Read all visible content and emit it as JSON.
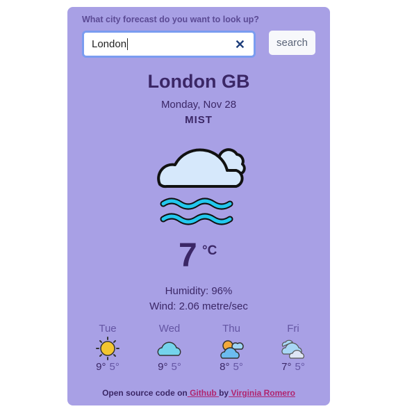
{
  "search": {
    "prompt": "What city forecast do you want to look up?",
    "value": "London",
    "clear_icon": "close-icon",
    "button": "search"
  },
  "current": {
    "city": "London GB",
    "date": "Monday, Nov 28",
    "description": "MIST",
    "icon": "mist-icon",
    "temp": "7",
    "unit": "°C",
    "humidity": "Humidity: 96%",
    "wind": "Wind: 2.06 metre/sec"
  },
  "forecast": [
    {
      "day": "Tue",
      "icon": "sun-icon",
      "max": "9°",
      "min": "5°"
    },
    {
      "day": "Wed",
      "icon": "cloud-icon",
      "max": "9°",
      "min": "5°"
    },
    {
      "day": "Thu",
      "icon": "partly-cloudy-icon",
      "max": "8°",
      "min": "5°"
    },
    {
      "day": "Fri",
      "icon": "clouds-icon",
      "max": "7°",
      "min": "5°"
    }
  ],
  "footer": {
    "prefix": "Open source code on",
    "github": " Github ",
    "by": "by",
    "author": " Virginia Romero"
  },
  "colors": {
    "card": "#a8a0e5",
    "text": "#3b2766",
    "link": "#b0246e"
  }
}
